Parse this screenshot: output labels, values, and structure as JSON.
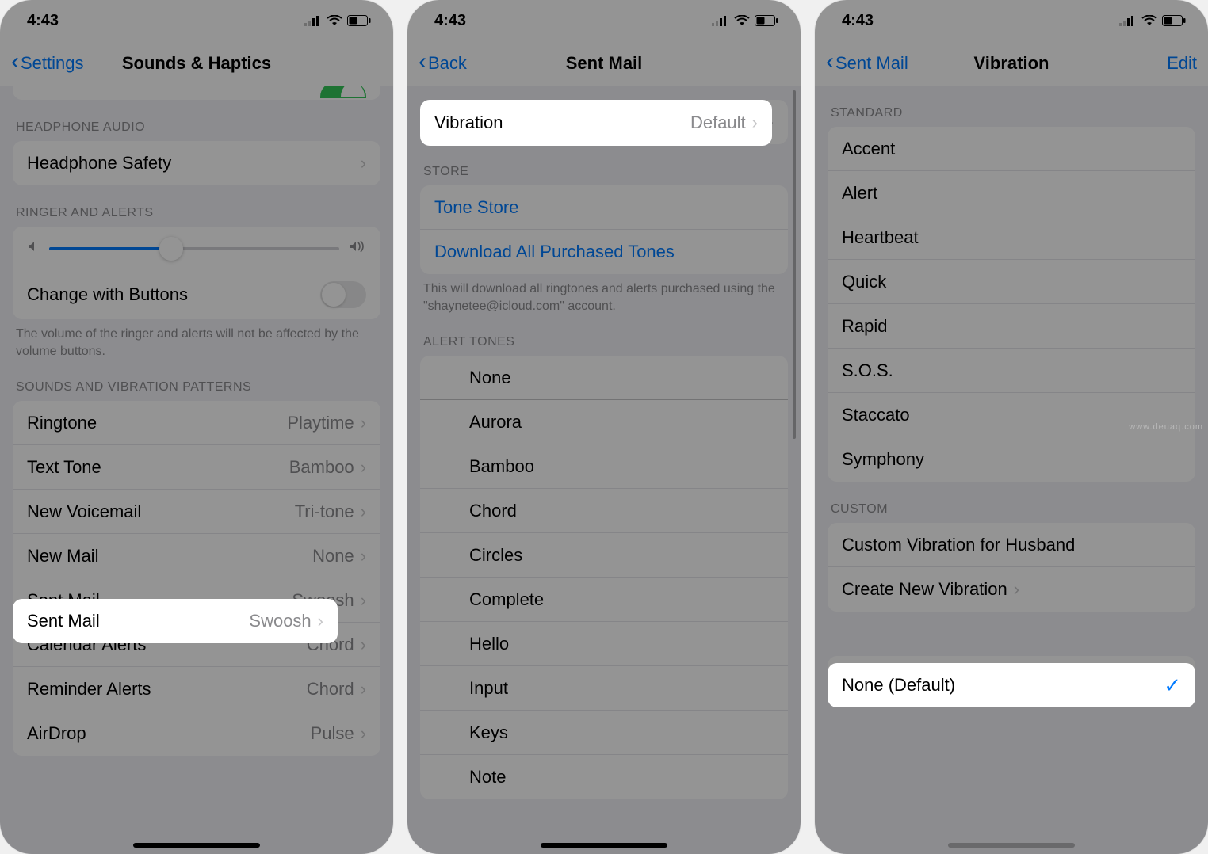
{
  "status": {
    "time": "4:43"
  },
  "colors": {
    "accent": "#007aff",
    "green": "#34c759"
  },
  "watermark": "www.deuaq.com",
  "screen1": {
    "back_label": "Settings",
    "title": "Sounds & Haptics",
    "sec_headphone": "HEADPHONE AUDIO",
    "headphone_safety": "Headphone Safety",
    "sec_ringer": "RINGER AND ALERTS",
    "change_buttons": "Change with Buttons",
    "ringer_footer": "The volume of the ringer and alerts will not be affected by the volume buttons.",
    "sec_patterns": "SOUNDS AND VIBRATION PATTERNS",
    "rows": [
      {
        "label": "Ringtone",
        "value": "Playtime"
      },
      {
        "label": "Text Tone",
        "value": "Bamboo"
      },
      {
        "label": "New Voicemail",
        "value": "Tri-tone"
      },
      {
        "label": "New Mail",
        "value": "None"
      },
      {
        "label": "Sent Mail",
        "value": "Swoosh"
      },
      {
        "label": "Calendar Alerts",
        "value": "Chord"
      },
      {
        "label": "Reminder Alerts",
        "value": "Chord"
      },
      {
        "label": "AirDrop",
        "value": "Pulse"
      }
    ]
  },
  "screen2": {
    "back_label": "Back",
    "title": "Sent Mail",
    "vibration_label": "Vibration",
    "vibration_value": "Default",
    "sec_store": "STORE",
    "tone_store": "Tone Store",
    "download_all": "Download All Purchased Tones",
    "store_footer": "This will download all ringtones and alerts purchased using the \"shaynetee@icloud.com\" account.",
    "sec_alert": "ALERT TONES",
    "none": "None",
    "tones": [
      "Aurora",
      "Bamboo",
      "Chord",
      "Circles",
      "Complete",
      "Hello",
      "Input",
      "Keys",
      "Note"
    ]
  },
  "screen3": {
    "back_label": "Sent Mail",
    "title": "Vibration",
    "edit": "Edit",
    "sec_standard": "STANDARD",
    "standard": [
      "Accent",
      "Alert",
      "Heartbeat",
      "Quick",
      "Rapid",
      "S.O.S.",
      "Staccato",
      "Symphony"
    ],
    "sec_custom": "CUSTOM",
    "custom": [
      "Custom Vibration for Husband",
      "Create New Vibration"
    ],
    "none_label": "None (Default)"
  }
}
